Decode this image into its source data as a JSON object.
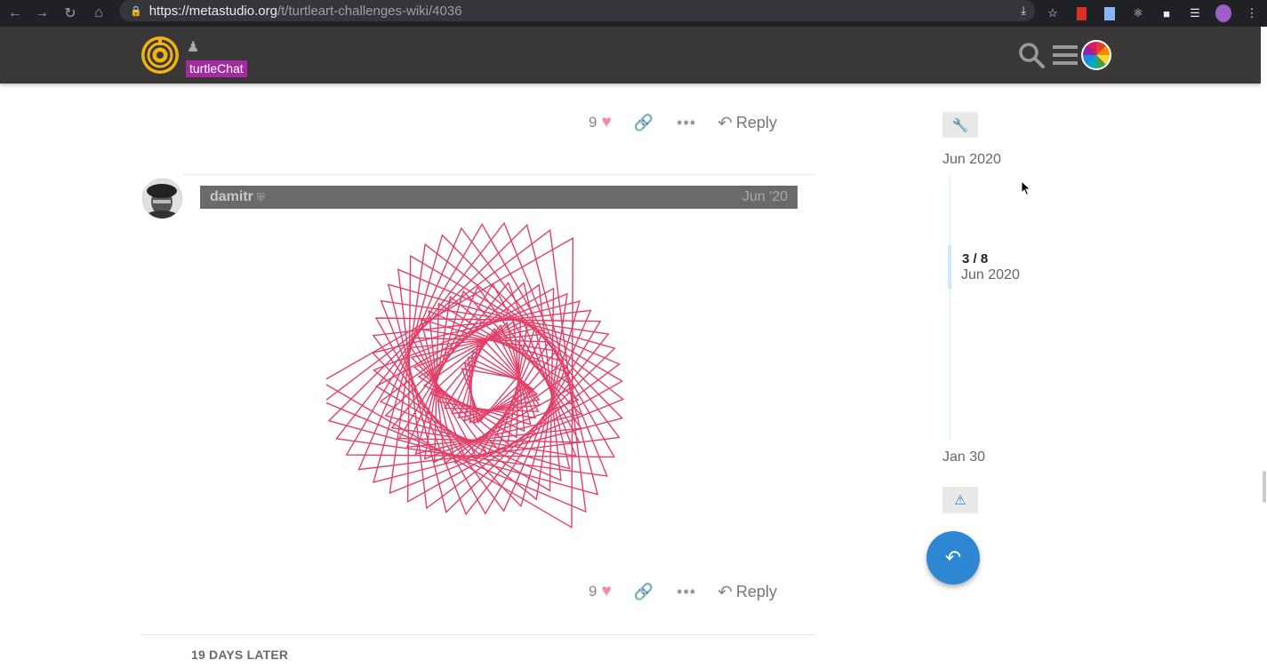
{
  "browser": {
    "url_host": "https://metastudio.org",
    "url_path": "/t/turtleart-challenges-wiki/4036"
  },
  "header": {
    "category": "turtleChat"
  },
  "post_prev": {
    "like_count": "9",
    "reply_label": "Reply"
  },
  "post": {
    "username": "damitr",
    "date": "Jun '20",
    "like_count": "9",
    "reply_label": "Reply"
  },
  "gap_label": "19 DAYS LATER",
  "timeline": {
    "top_date": "Jun 2020",
    "position": "3 / 8",
    "position_date": "Jun 2020",
    "bottom_date": "Jan 30"
  },
  "colors": {
    "header_bg": "#3a3837",
    "accent": "#2e87d3",
    "category": "#a42aa0",
    "drawing": "#e0406a"
  }
}
